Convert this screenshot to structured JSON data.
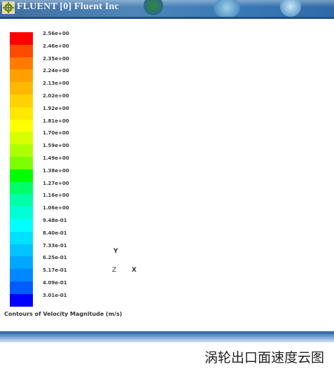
{
  "window": {
    "title": "FLUENT [0] Fluent Inc"
  },
  "legend": {
    "colors": [
      "#ff0000",
      "#ff4a00",
      "#ff7a00",
      "#ffa000",
      "#ffb800",
      "#ffd200",
      "#ffe800",
      "#ffff00",
      "#d8ff00",
      "#b0ff00",
      "#7cff00",
      "#00ff00",
      "#00ff66",
      "#00ffa8",
      "#00ffd6",
      "#00ffff",
      "#00e0ff",
      "#00c4ff",
      "#00a8ff",
      "#0088ff",
      "#005cff",
      "#0000ff"
    ],
    "labels": [
      "2.56e+00",
      "2.46e+00",
      "2.35e+00",
      "2.24e+00",
      "2.13e+00",
      "2.02e+00",
      "1.92e+00",
      "1.81e+00",
      "1.70e+00",
      "1.59e+00",
      "1.49e+00",
      "1.38e+00",
      "1.27e+00",
      "1.16e+00",
      "1.06e+00",
      "9.48e-01",
      "8.40e-01",
      "7.33e-01",
      "6.25e-01",
      "5.17e-01",
      "4.09e-01",
      "3.01e-01"
    ]
  },
  "axes": {
    "y": "Y",
    "z": "Z",
    "x": "X"
  },
  "contour_caption": "Contours of Velocity Magnitude (m/s)",
  "figure_caption": "涡轮出口面速度云图"
}
